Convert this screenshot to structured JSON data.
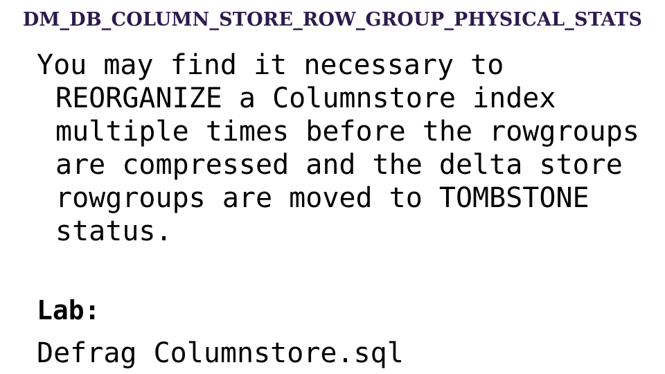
{
  "slide": {
    "title": "DM_DB_COLUMN_STORE_ROW_GROUP_PHYSICAL_STATS",
    "title_color": "#2d1b4e",
    "background_color": "#ffffff",
    "body_text": "You may find it necessary to REORGANIZE a Columnstore index multiple times before the rowgroups are compressed and the delta store rowgroups are moved to TOMBSTONE status.",
    "body_lines": [
      "You may find it necessary to",
      "REORGANIZE a Columnstore index",
      "multiple times before the",
      "rowgroups are compressed and the",
      "delta store rowgroups are moved to",
      "TOMBSTONE status."
    ],
    "body_color": "#000000",
    "lab": {
      "label": "Lab:",
      "file": "Defrag Columnstore.sql"
    }
  }
}
